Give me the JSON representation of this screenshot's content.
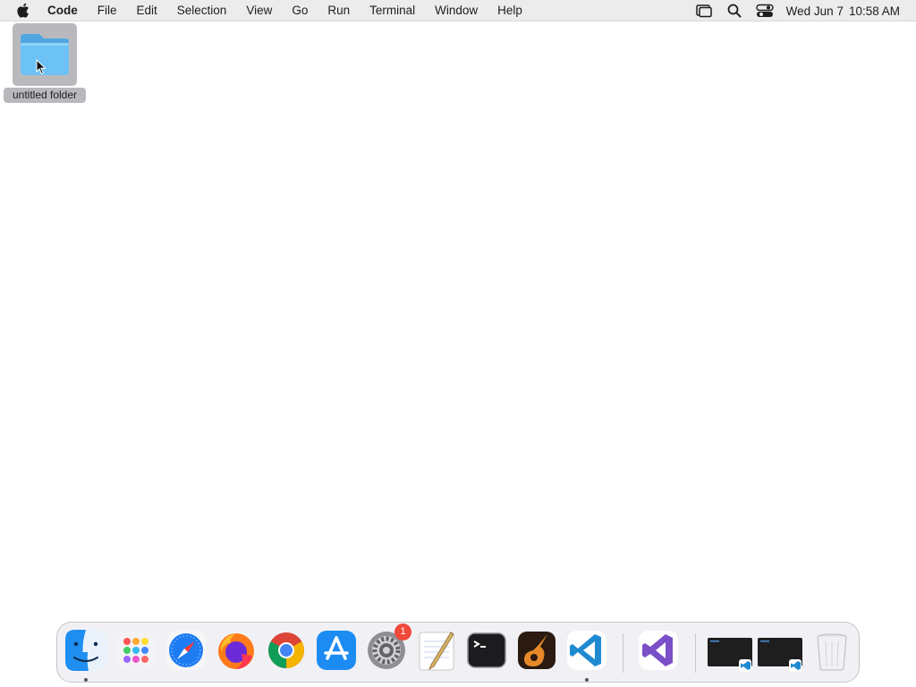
{
  "menubar": {
    "app_name": "Code",
    "items": [
      "File",
      "Edit",
      "Selection",
      "View",
      "Go",
      "Run",
      "Terminal",
      "Window",
      "Help"
    ],
    "clock_date": "Wed Jun 7",
    "clock_time": "10:58 AM",
    "status_icons": [
      "screen-mirroring-icon",
      "spotlight-search-icon",
      "control-center-icon"
    ]
  },
  "desktop": {
    "folder_label": "untitled folder"
  },
  "dock": {
    "apps": [
      "Finder",
      "Launchpad",
      "Safari",
      "Firefox",
      "Google Chrome",
      "App Store",
      "System Settings",
      "TextEdit",
      "Terminal",
      "GarageBand",
      "Visual Studio Code"
    ],
    "settings_badge": "1",
    "recent": [
      "Visual Studio"
    ],
    "windows": [
      "Visual Studio Code window 1",
      "Visual Studio Code window 2"
    ],
    "trash": "Trash",
    "colors": {
      "finder": "#1e8ef0",
      "safari": "#1e7cf2",
      "vscode": "#1f8ad2",
      "badge": "#f0493a"
    }
  }
}
